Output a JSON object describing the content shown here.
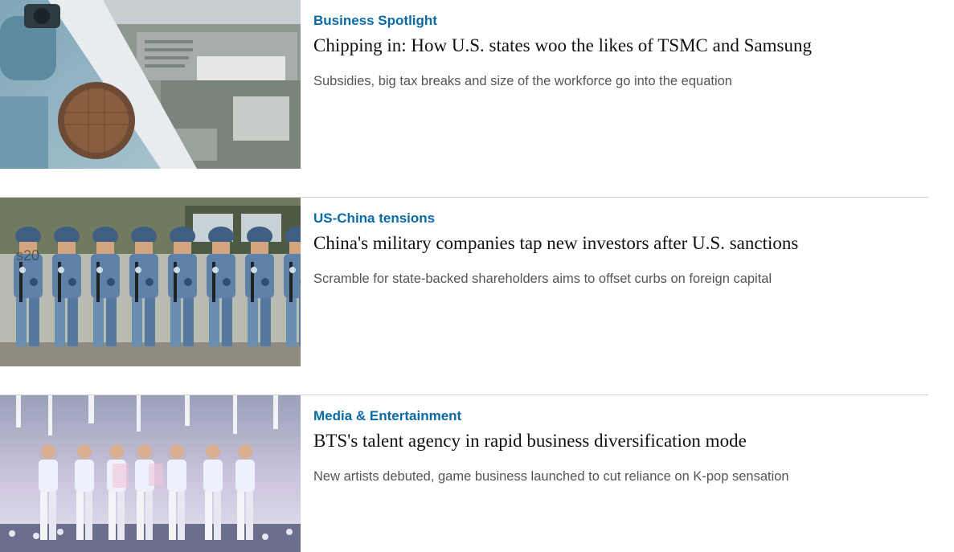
{
  "articles": [
    {
      "category": "Business Spotlight",
      "headline": "Chipping in: How U.S. states woo the likes of TSMC and Samsung",
      "summary": "Subsidies, big tax breaks and size of the workforce go into the equation",
      "image": "semiconductor-wafer-and-factory-photo"
    },
    {
      "category": "US-China tensions",
      "headline": "China's military companies tap new investors after U.S. sanctions",
      "summary": "Scramble for state-backed shareholders aims to offset curbs on foreign capital",
      "image": "marching-soldiers-photo"
    },
    {
      "category": "Media & Entertainment",
      "headline": "BTS's talent agency in rapid business diversification mode",
      "summary": "New artists debuted, game business launched to cut reliance on K-pop sensation",
      "image": "concert-stage-photo"
    }
  ],
  "colors": {
    "category": "#0a6aa8",
    "headline": "#111111",
    "summary": "#555555",
    "divider": "#d0d0d0"
  }
}
